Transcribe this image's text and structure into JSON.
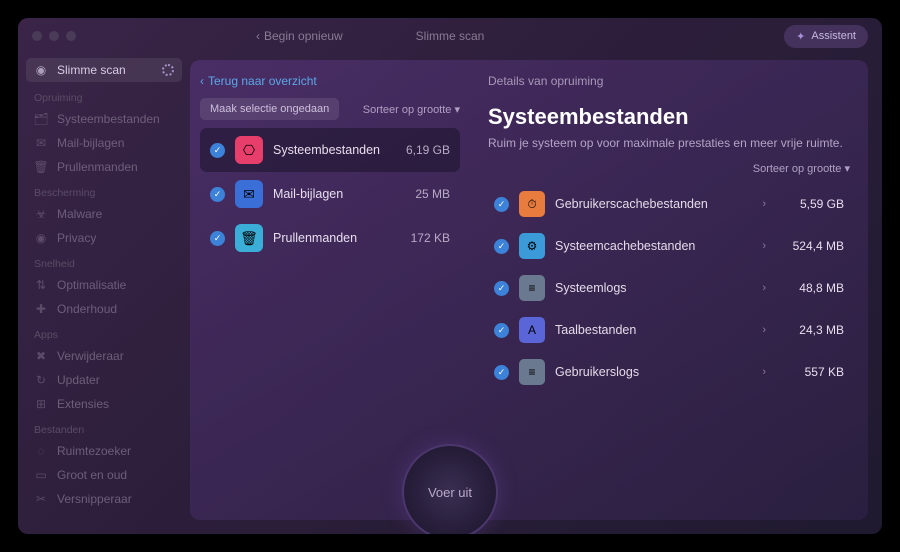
{
  "titlebar": {
    "back": "Begin opnieuw",
    "title": "Slimme scan",
    "assistant": "Assistent"
  },
  "sidebar": {
    "smart_scan": "Slimme scan",
    "groups": [
      {
        "header": "Opruiming",
        "items": [
          {
            "icon": "🗂",
            "label": "Systeembestanden"
          },
          {
            "icon": "✉",
            "label": "Mail-bijlagen"
          },
          {
            "icon": "🗑",
            "label": "Prullenmanden"
          }
        ]
      },
      {
        "header": "Bescherming",
        "items": [
          {
            "icon": "☣",
            "label": "Malware"
          },
          {
            "icon": "◉",
            "label": "Privacy"
          }
        ]
      },
      {
        "header": "Snelheid",
        "items": [
          {
            "icon": "⇅",
            "label": "Optimalisatie"
          },
          {
            "icon": "✚",
            "label": "Onderhoud"
          }
        ]
      },
      {
        "header": "Apps",
        "items": [
          {
            "icon": "✖",
            "label": "Verwijderaar"
          },
          {
            "icon": "↻",
            "label": "Updater"
          },
          {
            "icon": "⊞",
            "label": "Extensies"
          }
        ]
      },
      {
        "header": "Bestanden",
        "items": [
          {
            "icon": "◌",
            "label": "Ruimtezoeker"
          },
          {
            "icon": "▭",
            "label": "Groot en oud"
          },
          {
            "icon": "✂",
            "label": "Versnipperaar"
          }
        ]
      }
    ]
  },
  "panel": {
    "back": "Terug naar overzicht",
    "deselect": "Maak selectie ongedaan",
    "sort": "Sorteer op grootte ▾",
    "categories": [
      {
        "name": "Systeembestanden",
        "size": "6,19 GB",
        "color": "#e83e6b",
        "icon": "⎔",
        "selected": true
      },
      {
        "name": "Mail-bijlagen",
        "size": "25 MB",
        "color": "#3b6fd8",
        "icon": "✉",
        "selected": false
      },
      {
        "name": "Prullenmanden",
        "size": "172 KB",
        "color": "#3baed8",
        "icon": "🗑",
        "selected": false
      }
    ],
    "details": {
      "header": "Details van opruiming",
      "title": "Systeembestanden",
      "subtitle": "Ruim je systeem op voor maximale prestaties en meer vrije ruimte.",
      "sort": "Sorteer op grootte ▾",
      "items": [
        {
          "name": "Gebruikerscachebestanden",
          "size": "5,59 GB",
          "color": "#e87b3e",
          "icon": "⏱"
        },
        {
          "name": "Systeemcachebestanden",
          "size": "524,4 MB",
          "color": "#3b9bd8",
          "icon": "⚙"
        },
        {
          "name": "Systeemlogs",
          "size": "48,8 MB",
          "color": "#6a7890",
          "icon": "≡"
        },
        {
          "name": "Taalbestanden",
          "size": "24,3 MB",
          "color": "#5a66d8",
          "icon": "A"
        },
        {
          "name": "Gebruikerslogs",
          "size": "557 KB",
          "color": "#6a7890",
          "icon": "≡"
        }
      ]
    }
  },
  "run": "Voer uit"
}
